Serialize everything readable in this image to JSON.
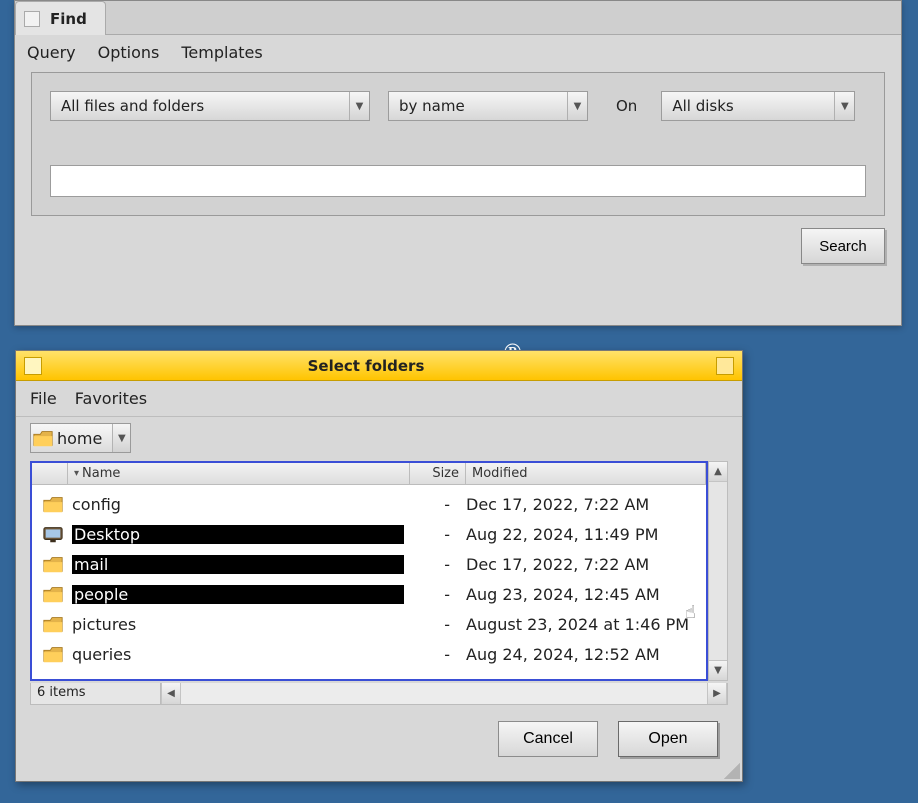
{
  "find_window": {
    "tab_label": "Find",
    "menus": [
      "Query",
      "Options",
      "Templates"
    ],
    "dd_scope": "All files and folders",
    "dd_method": "by name",
    "on_label": "On",
    "dd_location": "All disks",
    "search_value": "",
    "search_button": "Search"
  },
  "select_dialog": {
    "title": "Select folders",
    "menus": [
      "File",
      "Favorites"
    ],
    "location": "home",
    "columns": {
      "name": "Name",
      "size": "Size",
      "modified": "Modified"
    },
    "rows": [
      {
        "icon": "folder",
        "name": "config",
        "selected": false,
        "size": "-",
        "modified": "Dec 17, 2022, 7:22 AM"
      },
      {
        "icon": "desktop",
        "name": "Desktop",
        "selected": true,
        "size": "-",
        "modified": "Aug 22, 2024, 11:49 PM"
      },
      {
        "icon": "folder",
        "name": "mail",
        "selected": true,
        "size": "-",
        "modified": "Dec 17, 2022, 7:22 AM"
      },
      {
        "icon": "folder",
        "name": "people",
        "selected": true,
        "size": "-",
        "modified": "Aug 23, 2024, 12:45 AM"
      },
      {
        "icon": "folder",
        "name": "pictures",
        "selected": false,
        "size": "-",
        "modified": "August 23, 2024 at 1:46 PM"
      },
      {
        "icon": "folder",
        "name": "queries",
        "selected": false,
        "size": "-",
        "modified": "Aug 24, 2024, 12:52 AM"
      }
    ],
    "status": "6 items",
    "cancel": "Cancel",
    "open": "Open"
  }
}
